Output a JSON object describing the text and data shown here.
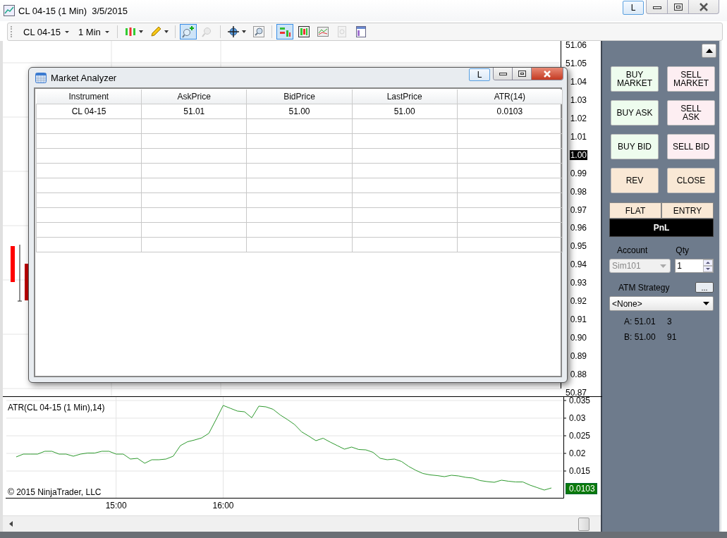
{
  "window": {
    "title": "CL 04-15 (1 Min)  3/5/2015",
    "layout_button": "L"
  },
  "toolbar": {
    "instrument": "CL 04-15",
    "interval": "1 Min",
    "tools": [
      {
        "kind": "candles",
        "selected": false,
        "disabled": false
      },
      {
        "kind": "pencil",
        "selected": false,
        "disabled": false
      },
      {
        "kind": "zoom-in",
        "selected": true,
        "disabled": false
      },
      {
        "kind": "zoom-out",
        "selected": false,
        "disabled": true
      },
      {
        "kind": "crosshair",
        "selected": false,
        "disabled": false
      },
      {
        "kind": "zoom-box",
        "selected": false,
        "disabled": false
      },
      {
        "kind": "chart-trader",
        "selected": true,
        "disabled": false
      },
      {
        "kind": "data-bars",
        "selected": false,
        "disabled": false
      },
      {
        "kind": "indicators",
        "selected": false,
        "disabled": false
      },
      {
        "kind": "strategy",
        "selected": false,
        "disabled": true
      },
      {
        "kind": "properties",
        "selected": false,
        "disabled": false
      }
    ]
  },
  "price_axis": {
    "labels": [
      {
        "text": "51.06",
        "highlighted": false
      },
      {
        "text": "51.05",
        "highlighted": false
      },
      {
        "text": "1.04",
        "highlighted": false
      },
      {
        "text": "1.03",
        "highlighted": false
      },
      {
        "text": "1.02",
        "highlighted": false
      },
      {
        "text": "1.01",
        "highlighted": false
      },
      {
        "text": "1.00",
        "highlighted": true
      },
      {
        "text": "0.99",
        "highlighted": false
      },
      {
        "text": "0.98",
        "highlighted": false
      },
      {
        "text": "0.97",
        "highlighted": false
      },
      {
        "text": "0.96",
        "highlighted": false
      },
      {
        "text": "0.95",
        "highlighted": false
      },
      {
        "text": "0.94",
        "highlighted": false
      },
      {
        "text": "0.93",
        "highlighted": false
      },
      {
        "text": "0.92",
        "highlighted": false
      },
      {
        "text": "0.91",
        "highlighted": false
      },
      {
        "text": "0.90",
        "highlighted": false
      },
      {
        "text": "0.89",
        "highlighted": false
      },
      {
        "text": "0.88",
        "highlighted": false
      },
      {
        "text": "50.87",
        "highlighted": false
      }
    ]
  },
  "indicator_panel": {
    "copyright": "© 2015 NinjaTrader, LLC",
    "last_value": "0.0103",
    "chart_data": {
      "type": "line",
      "grid": true,
      "categories": [
        null,
        null,
        null,
        null,
        null,
        null,
        null,
        null,
        null,
        null,
        null,
        null,
        null,
        null,
        "15:00",
        null,
        null,
        null,
        null,
        null,
        null,
        null,
        null,
        null,
        null,
        null,
        null,
        null,
        null,
        "16:00",
        null,
        null,
        null,
        null,
        null,
        null,
        null,
        null,
        null,
        null,
        null,
        null,
        null,
        null,
        null,
        null,
        null,
        null,
        null,
        null,
        null,
        null,
        null,
        null,
        null,
        null,
        null,
        null,
        null,
        null,
        null,
        null,
        null,
        null,
        null,
        null,
        null,
        null,
        null,
        null,
        null,
        null,
        null,
        null,
        null,
        null
      ],
      "ylim": [
        0.0074,
        0.036
      ],
      "yticks": [
        {
          "value": 0.015,
          "label": "0.015"
        },
        {
          "value": 0.02,
          "label": "0.02"
        },
        {
          "value": 0.025,
          "label": "0.025"
        },
        {
          "value": 0.03,
          "label": "0.03"
        },
        {
          "value": 0.035,
          "label": "0.035"
        }
      ],
      "series": [
        {
          "name": "ATR(CL 04-15 (1 Min),14)",
          "color": "#2e9a2e",
          "values": [
            0.019,
            0.0198,
            0.0198,
            0.0198,
            0.0206,
            0.0206,
            0.0198,
            0.0198,
            0.0192,
            0.0198,
            0.0201,
            0.0201,
            0.0206,
            0.0206,
            0.0198,
            0.0198,
            0.0184,
            0.0186,
            0.0172,
            0.0182,
            0.0182,
            0.0184,
            0.0192,
            0.0222,
            0.0233,
            0.0238,
            0.0244,
            0.0257,
            0.0296,
            0.0336,
            0.0328,
            0.032,
            0.0318,
            0.0301,
            0.0334,
            0.0332,
            0.0325,
            0.0309,
            0.0296,
            0.0282,
            0.0261,
            0.0249,
            0.0236,
            0.0243,
            0.0232,
            0.0222,
            0.0212,
            0.0218,
            0.0211,
            0.021,
            0.0203,
            0.0186,
            0.0182,
            0.0184,
            0.0177,
            0.0163,
            0.0152,
            0.0143,
            0.0139,
            0.0137,
            0.0134,
            0.0138,
            0.0136,
            0.0132,
            0.013,
            0.0123,
            0.012,
            0.0118,
            0.0124,
            0.0121,
            0.0119,
            0.0119,
            0.011,
            0.0103,
            0.0096,
            0.0102
          ]
        }
      ]
    }
  },
  "market_analyzer": {
    "title": "Market Analyzer",
    "layout_button": "L",
    "columns": [
      "Instrument",
      "AskPrice",
      "BidPrice",
      "LastPrice",
      "ATR(14)"
    ],
    "rows": [
      [
        "CL 04-15",
        "51.01",
        "51.00",
        "51.00",
        "0.0103"
      ]
    ]
  },
  "chart_trader": {
    "order_buttons": [
      {
        "label": "BUY MARKET",
        "kind": "buy"
      },
      {
        "label": "SELL MARKET",
        "kind": "sell"
      },
      {
        "label": "BUY ASK",
        "kind": "buy"
      },
      {
        "label": "SELL ASK",
        "kind": "sell"
      },
      {
        "label": "BUY BID",
        "kind": "buy"
      },
      {
        "label": "SELL BID",
        "kind": "sell"
      },
      {
        "label": "REV",
        "kind": "neutral"
      },
      {
        "label": "CLOSE",
        "kind": "neutral"
      }
    ],
    "position_buttons": [
      "FLAT",
      "ENTRY"
    ],
    "pnl": "PnL",
    "account": {
      "label": "Account",
      "value": "Sim101",
      "disabled": true
    },
    "qty": {
      "label": "Qty",
      "value": "1"
    },
    "atm": {
      "label": "ATM Strategy",
      "more_button": "...",
      "value": "<None>"
    },
    "quotes": [
      {
        "label": "A: 51.01",
        "size": "3"
      },
      {
        "label": "B: 51.00",
        "size": "91"
      }
    ]
  }
}
